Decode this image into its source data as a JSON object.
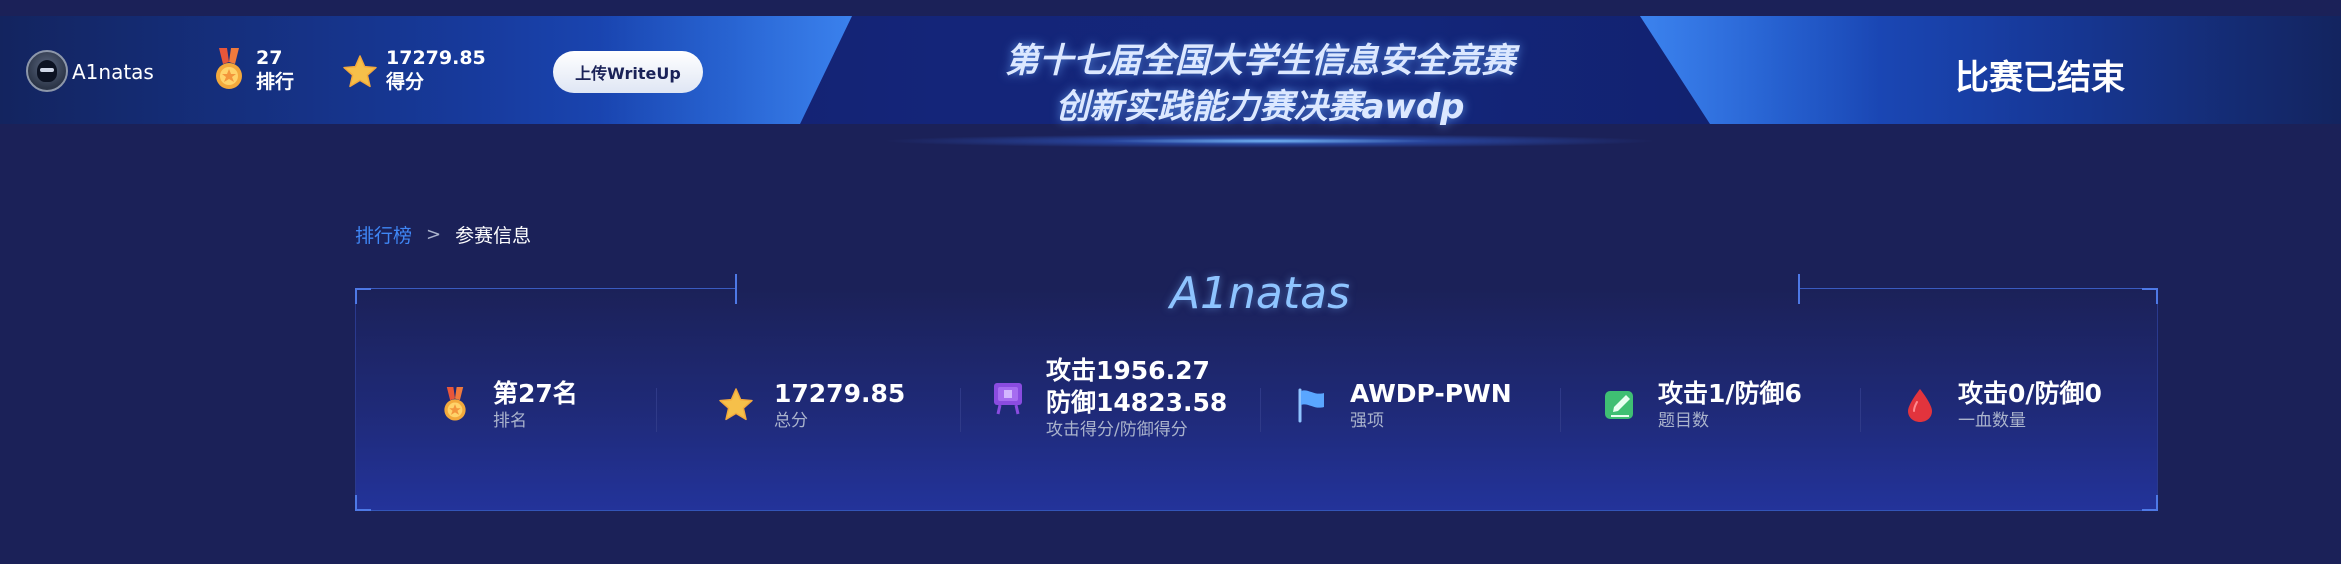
{
  "user": {
    "name": "A1natas"
  },
  "header": {
    "rank_value": "27",
    "rank_label": "排行",
    "score_value": "17279.85",
    "score_label": "得分",
    "writeup_label": "上传WriteUp",
    "title_line1": "第十七届全国大学生信息安全竞赛",
    "title_line2": "创新实践能力赛决赛awdp",
    "status": "比赛已结束"
  },
  "breadcrumb": {
    "root": "排行榜",
    "separator": ">",
    "current": "参赛信息"
  },
  "card": {
    "team_name": "A1natas",
    "stats": [
      {
        "value": "第27名",
        "label": "排名",
        "icon": "medal-icon"
      },
      {
        "value": "17279.85",
        "label": "总分",
        "icon": "star-icon"
      },
      {
        "value": "攻击1956.27",
        "value2": "防御14823.58",
        "label": "攻击得分/防御得分",
        "icon": "flag-banner-icon"
      },
      {
        "value": "AWDP-PWN",
        "label": "强项",
        "icon": "flag-icon"
      },
      {
        "value": "攻击1/防御6",
        "label": "题目数",
        "icon": "edit-icon"
      },
      {
        "value": "攻击0/防御0",
        "label": "一血数量",
        "icon": "blood-drop-icon"
      }
    ]
  },
  "colors": {
    "background": "#1b2158",
    "accent_blue": "#3f86f5",
    "team_name": "#8ec4ff",
    "label_gray": "#aab3cc"
  }
}
